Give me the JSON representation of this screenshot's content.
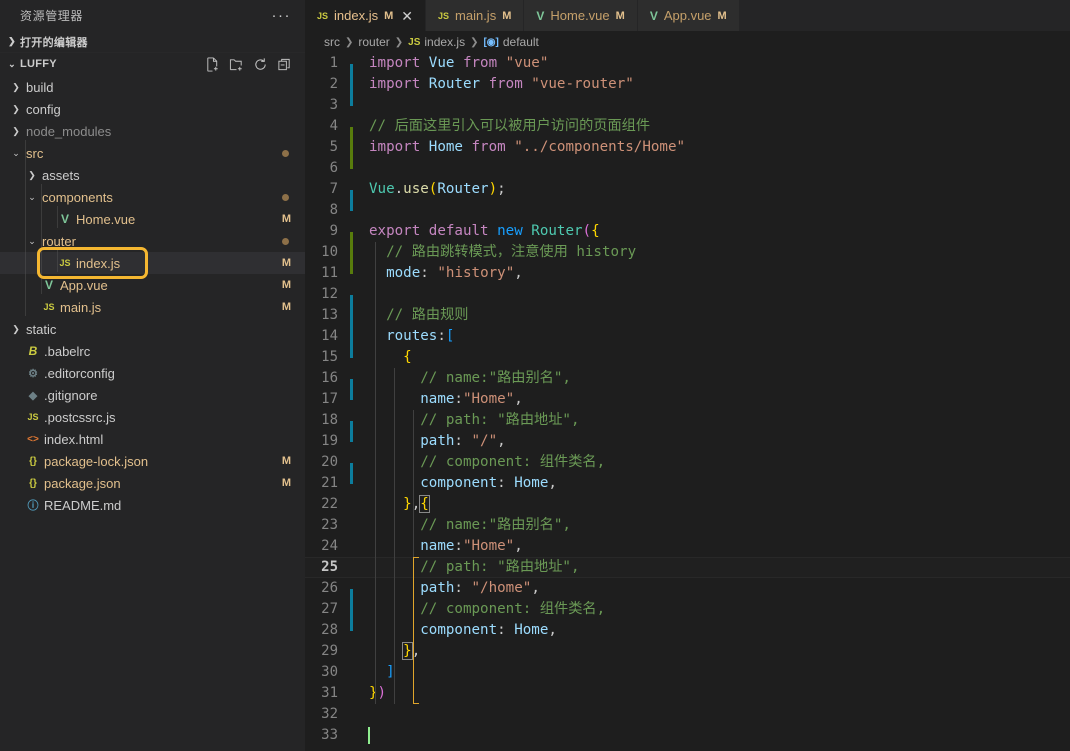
{
  "sidebar": {
    "title": "资源管理器",
    "more_label": "···",
    "open_editors": {
      "label": "打开的编辑器",
      "expanded": false
    },
    "project": {
      "label": "LUFFY",
      "expanded": true
    },
    "actions": [
      {
        "name": "new-file",
        "label": "新建文件"
      },
      {
        "name": "new-folder",
        "label": "新建文件夹"
      },
      {
        "name": "refresh",
        "label": "刷新"
      },
      {
        "name": "collapse-all",
        "label": "全部折叠"
      }
    ],
    "items": [
      {
        "label": "build",
        "type": "folder",
        "indent": 1,
        "expanded": false,
        "icon": "chevron-right",
        "badge": "",
        "dot": false,
        "color": "folder"
      },
      {
        "label": "config",
        "type": "folder",
        "indent": 1,
        "expanded": false,
        "icon": "chevron-right",
        "badge": "",
        "dot": false,
        "color": "folder"
      },
      {
        "label": "node_modules",
        "type": "folder",
        "indent": 1,
        "expanded": false,
        "icon": "chevron-right",
        "badge": "",
        "dot": false,
        "color": "dim"
      },
      {
        "label": "src",
        "type": "folder",
        "indent": 1,
        "expanded": true,
        "icon": "chevron-down",
        "badge": "",
        "dot": true,
        "color": "mod"
      },
      {
        "label": "assets",
        "type": "folder",
        "indent": 2,
        "expanded": false,
        "icon": "chevron-right",
        "badge": "",
        "dot": false,
        "color": "folder"
      },
      {
        "label": "components",
        "type": "folder",
        "indent": 2,
        "expanded": true,
        "icon": "chevron-down",
        "badge": "",
        "dot": true,
        "color": "mod"
      },
      {
        "label": "Home.vue",
        "type": "file",
        "indent": 3,
        "fileicon": "vue",
        "badge": "M",
        "dot": false,
        "color": "mod"
      },
      {
        "label": "router",
        "type": "folder",
        "indent": 2,
        "expanded": true,
        "icon": "chevron-down",
        "badge": "",
        "dot": true,
        "color": "mod",
        "selected": false
      },
      {
        "label": "index.js",
        "type": "file",
        "indent": 3,
        "fileicon": "js",
        "badge": "M",
        "dot": false,
        "color": "mod",
        "selected": true,
        "highlighted": true
      },
      {
        "label": "App.vue",
        "type": "file",
        "indent": 2,
        "fileicon": "vue",
        "badge": "M",
        "dot": false,
        "color": "mod"
      },
      {
        "label": "main.js",
        "type": "file",
        "indent": 2,
        "fileicon": "js",
        "badge": "M",
        "dot": false,
        "color": "mod"
      },
      {
        "label": "static",
        "type": "folder",
        "indent": 1,
        "expanded": false,
        "icon": "chevron-right",
        "badge": "",
        "dot": false,
        "color": "folder"
      },
      {
        "label": ".babelrc",
        "type": "file",
        "indent": 1,
        "fileicon": "babel",
        "badge": "",
        "dot": false,
        "color": "file"
      },
      {
        "label": ".editorconfig",
        "type": "file",
        "indent": 1,
        "fileicon": "gear",
        "badge": "",
        "dot": false,
        "color": "file"
      },
      {
        "label": ".gitignore",
        "type": "file",
        "indent": 1,
        "fileicon": "git",
        "badge": "",
        "dot": false,
        "color": "file"
      },
      {
        "label": ".postcssrc.js",
        "type": "file",
        "indent": 1,
        "fileicon": "js",
        "badge": "",
        "dot": false,
        "color": "file"
      },
      {
        "label": "index.html",
        "type": "file",
        "indent": 1,
        "fileicon": "html",
        "badge": "",
        "dot": false,
        "color": "file"
      },
      {
        "label": "package-lock.json",
        "type": "file",
        "indent": 1,
        "fileicon": "json",
        "badge": "M",
        "dot": false,
        "color": "mod"
      },
      {
        "label": "package.json",
        "type": "file",
        "indent": 1,
        "fileicon": "json",
        "badge": "M",
        "dot": false,
        "color": "mod"
      },
      {
        "label": "README.md",
        "type": "file",
        "indent": 1,
        "fileicon": "info",
        "badge": "",
        "dot": false,
        "color": "file"
      }
    ]
  },
  "tabs": [
    {
      "label": "index.js",
      "icon": "js",
      "dirty": "M",
      "active": true,
      "close": "✕"
    },
    {
      "label": "main.js",
      "icon": "js",
      "dirty": "M",
      "active": false,
      "close": ""
    },
    {
      "label": "Home.vue",
      "icon": "vue",
      "dirty": "M",
      "active": false,
      "close": ""
    },
    {
      "label": "App.vue",
      "icon": "vue",
      "dirty": "M",
      "active": false,
      "close": ""
    }
  ],
  "breadcrumb": [
    {
      "label": "src",
      "icon": ""
    },
    {
      "label": "router",
      "icon": ""
    },
    {
      "label": "index.js",
      "icon": "js"
    },
    {
      "label": "default",
      "icon": "symbol-object"
    }
  ],
  "editor": {
    "current_line": 25,
    "total_lines": 33,
    "language": "JavaScript",
    "lines": [
      {
        "n": 1,
        "gutter": "mod",
        "tokens": [
          {
            "t": "import ",
            "c": "k"
          },
          {
            "t": "Vue",
            "c": "var"
          },
          {
            "t": " from ",
            "c": "k"
          },
          {
            "t": "\"vue\"",
            "c": "str"
          }
        ]
      },
      {
        "n": 2,
        "gutter": "mod",
        "tokens": [
          {
            "t": "import ",
            "c": "k"
          },
          {
            "t": "Router",
            "c": "var"
          },
          {
            "t": " from ",
            "c": "k"
          },
          {
            "t": "\"vue-router\"",
            "c": "str"
          }
        ]
      },
      {
        "n": 3,
        "gutter": "",
        "tokens": []
      },
      {
        "n": 4,
        "gutter": "add",
        "tokens": [
          {
            "t": "// 后面这里引入可以被用户访问的页面组件",
            "c": "cmt"
          }
        ]
      },
      {
        "n": 5,
        "gutter": "add",
        "tokens": [
          {
            "t": "import ",
            "c": "k"
          },
          {
            "t": "Home",
            "c": "var"
          },
          {
            "t": " from ",
            "c": "k"
          },
          {
            "t": "\"../components/Home\"",
            "c": "str"
          }
        ]
      },
      {
        "n": 6,
        "gutter": "",
        "tokens": []
      },
      {
        "n": 7,
        "gutter": "mod",
        "tokens": [
          {
            "t": "Vue",
            "c": "typ"
          },
          {
            "t": ".",
            "c": "pun"
          },
          {
            "t": "use",
            "c": "fn"
          },
          {
            "t": "(",
            "c": "y1"
          },
          {
            "t": "Router",
            "c": "var"
          },
          {
            "t": ")",
            "c": "y1"
          },
          {
            "t": ";",
            "c": "pun"
          }
        ]
      },
      {
        "n": 8,
        "gutter": "",
        "tokens": []
      },
      {
        "n": 9,
        "gutter": "add",
        "tokens": [
          {
            "t": "export default ",
            "c": "k"
          },
          {
            "t": "new ",
            "c": "b1"
          },
          {
            "t": "Router",
            "c": "typ"
          },
          {
            "t": "(",
            "c": "y2"
          },
          {
            "t": "{",
            "c": "y1"
          }
        ]
      },
      {
        "n": 10,
        "gutter": "add",
        "tokens": [
          {
            "t": "  // 路由跳转模式，注意使用 history",
            "c": "cmt"
          }
        ]
      },
      {
        "n": 11,
        "gutter": "",
        "tokens": [
          {
            "t": "  ",
            "c": "w"
          },
          {
            "t": "mode",
            "c": "var"
          },
          {
            "t": ": ",
            "c": "pun"
          },
          {
            "t": "\"history\"",
            "c": "str"
          },
          {
            "t": ",",
            "c": "pun"
          }
        ]
      },
      {
        "n": 12,
        "gutter": "mod",
        "tokens": []
      },
      {
        "n": 13,
        "gutter": "mod",
        "tokens": [
          {
            "t": "  // 路由规则",
            "c": "cmt"
          }
        ]
      },
      {
        "n": 14,
        "gutter": "mod",
        "tokens": [
          {
            "t": "  ",
            "c": "w"
          },
          {
            "t": "routes",
            "c": "var"
          },
          {
            "t": ":",
            "c": "pun"
          },
          {
            "t": "[",
            "c": "b1"
          }
        ]
      },
      {
        "n": 15,
        "gutter": "",
        "tokens": [
          {
            "t": "    ",
            "c": "w"
          },
          {
            "t": "{",
            "c": "y1"
          }
        ]
      },
      {
        "n": 16,
        "gutter": "mod",
        "tokens": [
          {
            "t": "      // name:\"路由别名\",",
            "c": "cmt"
          }
        ]
      },
      {
        "n": 17,
        "gutter": "",
        "tokens": [
          {
            "t": "      ",
            "c": "w"
          },
          {
            "t": "name",
            "c": "var"
          },
          {
            "t": ":",
            "c": "pun"
          },
          {
            "t": "\"Home\"",
            "c": "str"
          },
          {
            "t": ",",
            "c": "pun"
          }
        ]
      },
      {
        "n": 18,
        "gutter": "mod",
        "tokens": [
          {
            "t": "      // path: \"路由地址\",",
            "c": "cmt"
          }
        ]
      },
      {
        "n": 19,
        "gutter": "",
        "tokens": [
          {
            "t": "      ",
            "c": "w"
          },
          {
            "t": "path",
            "c": "var"
          },
          {
            "t": ": ",
            "c": "pun"
          },
          {
            "t": "\"/\"",
            "c": "str"
          },
          {
            "t": ",",
            "c": "pun"
          }
        ]
      },
      {
        "n": 20,
        "gutter": "mod",
        "tokens": [
          {
            "t": "      // component: 组件类名,",
            "c": "cmt"
          }
        ]
      },
      {
        "n": 21,
        "gutter": "",
        "tokens": [
          {
            "t": "      ",
            "c": "w"
          },
          {
            "t": "component",
            "c": "var"
          },
          {
            "t": ": ",
            "c": "pun"
          },
          {
            "t": "Home",
            "c": "var"
          },
          {
            "t": ",",
            "c": "pun"
          }
        ]
      },
      {
        "n": 22,
        "gutter": "",
        "tokens": [
          {
            "t": "    ",
            "c": "w"
          },
          {
            "t": "}",
            "c": "y1"
          },
          {
            "t": ",",
            "c": "pun"
          },
          {
            "t": "{",
            "c": "y1 bkt"
          }
        ]
      },
      {
        "n": 23,
        "gutter": "",
        "tokens": [
          {
            "t": "      // name:\"路由别名\",",
            "c": "cmt"
          }
        ]
      },
      {
        "n": 24,
        "gutter": "",
        "tokens": [
          {
            "t": "      ",
            "c": "w"
          },
          {
            "t": "name",
            "c": "var"
          },
          {
            "t": ":",
            "c": "pun"
          },
          {
            "t": "\"Home\"",
            "c": "str"
          },
          {
            "t": ",",
            "c": "pun"
          }
        ]
      },
      {
        "n": 25,
        "gutter": "",
        "tokens": [
          {
            "t": "      // path: \"路由地址\",",
            "c": "cmt"
          }
        ]
      },
      {
        "n": 26,
        "gutter": "mod",
        "tokens": [
          {
            "t": "      ",
            "c": "w"
          },
          {
            "t": "path",
            "c": "var"
          },
          {
            "t": ": ",
            "c": "pun"
          },
          {
            "t": "\"/home\"",
            "c": "str"
          },
          {
            "t": ",",
            "c": "pun"
          }
        ]
      },
      {
        "n": 27,
        "gutter": "mod",
        "tokens": [
          {
            "t": "      // component: 组件类名,",
            "c": "cmt"
          }
        ]
      },
      {
        "n": 28,
        "gutter": "",
        "tokens": [
          {
            "t": "      ",
            "c": "w"
          },
          {
            "t": "component",
            "c": "var"
          },
          {
            "t": ": ",
            "c": "pun"
          },
          {
            "t": "Home",
            "c": "var"
          },
          {
            "t": ",",
            "c": "pun"
          }
        ]
      },
      {
        "n": 29,
        "gutter": "",
        "tokens": [
          {
            "t": "    ",
            "c": "w"
          },
          {
            "t": "}",
            "c": "y1 bkt"
          },
          {
            "t": ",",
            "c": "pun"
          }
        ]
      },
      {
        "n": 30,
        "gutter": "",
        "tokens": [
          {
            "t": "  ",
            "c": "w"
          },
          {
            "t": "]",
            "c": "b1"
          }
        ]
      },
      {
        "n": 31,
        "gutter": "",
        "tokens": [
          {
            "t": "}",
            "c": "y1"
          },
          {
            "t": ")",
            "c": "y2"
          }
        ]
      },
      {
        "n": 32,
        "gutter": "",
        "tokens": []
      },
      {
        "n": 33,
        "gutter": "",
        "tokens": [],
        "cursor": true
      }
    ]
  },
  "colors": {
    "highlight_box": "#f5b731",
    "sidebar_bg": "#252526",
    "editor_bg": "#1e1e1e",
    "tab_inactive_bg": "#2d2d2d",
    "modified_badge": "#e2c08d",
    "git_modified": "#0c7d9d",
    "git_added": "#587c0c"
  }
}
